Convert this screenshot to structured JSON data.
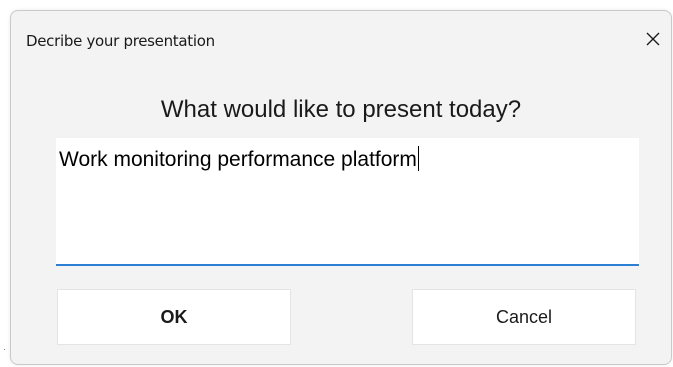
{
  "dialog": {
    "title": "Decribe your presentation",
    "close_icon": "close-icon",
    "prompt": "What would like to present today?",
    "input_value": "Work monitoring performance platform",
    "ok_label": "OK",
    "cancel_label": "Cancel"
  },
  "colors": {
    "dialog_background": "#f3f3f3",
    "input_focus_underline": "#2b7fd4",
    "button_background": "#ffffff"
  }
}
